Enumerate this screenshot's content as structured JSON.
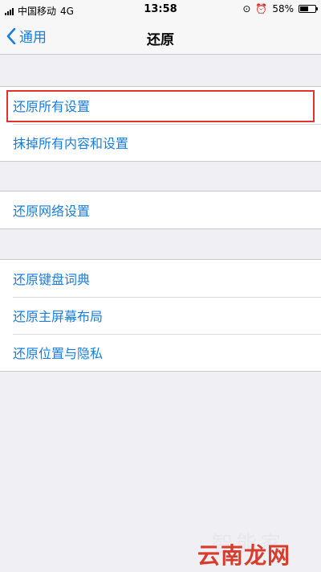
{
  "statusbar": {
    "carrier": "中国移动",
    "network": "4G",
    "time": "13:58",
    "battery_text": "58%",
    "battery_level": 0.58
  },
  "nav": {
    "back_label": "通用",
    "title": "还原"
  },
  "groups": [
    {
      "items": [
        "还原所有设置",
        "抹掉所有内容和设置"
      ]
    },
    {
      "items": [
        "还原网络设置"
      ]
    },
    {
      "items": [
        "还原键盘词典",
        "还原主屏幕布局",
        "还原位置与隐私"
      ]
    }
  ],
  "watermark": {
    "faded_text": "智能家",
    "main_text": "云南龙网"
  },
  "colors": {
    "accent": "#1a7de0",
    "highlight": "#e0332d",
    "background": "#efeff4"
  }
}
